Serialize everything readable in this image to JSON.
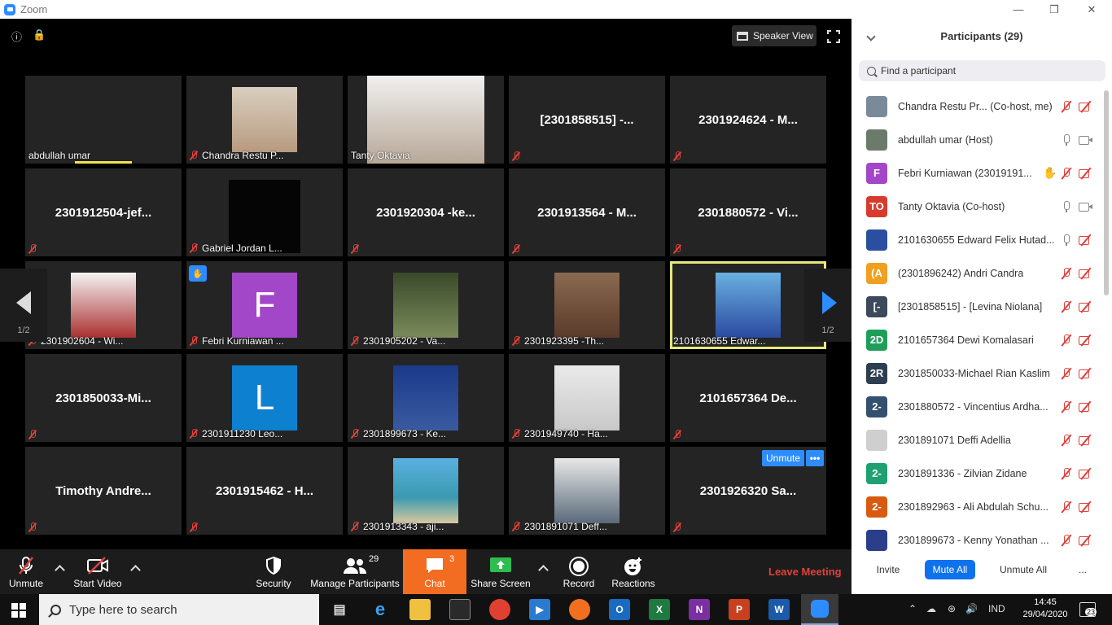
{
  "window": {
    "title": "Zoom"
  },
  "video": {
    "speaker_view_label": "Speaker View",
    "page_indicator": "1/2",
    "tiles": [
      {
        "label": "abdullah umar",
        "center": "",
        "muted": false
      },
      {
        "label": "Chandra Restu P...",
        "center": "",
        "muted": true
      },
      {
        "label": "Tanty Oktavia",
        "center": "",
        "muted": false
      },
      {
        "label": "",
        "center": "[2301858515] -...",
        "muted": true
      },
      {
        "label": "",
        "center": "2301924624 - M...",
        "muted": true
      },
      {
        "label": "",
        "center": "2301912504-jef...",
        "muted": true
      },
      {
        "label": "Gabriel Jordan L...",
        "center": "",
        "muted": true
      },
      {
        "label": "",
        "center": "2301920304 -ke...",
        "muted": true
      },
      {
        "label": "",
        "center": "2301913564 - M...",
        "muted": true
      },
      {
        "label": "",
        "center": "2301880572 - Vi...",
        "muted": true
      },
      {
        "label": "2301902604 - Wi...",
        "center": "",
        "muted": true
      },
      {
        "label": "Febri Kurniawan ...",
        "center": "",
        "muted": true,
        "avatar": "F"
      },
      {
        "label": "2301905202 - Va...",
        "center": "",
        "muted": true
      },
      {
        "label": "2301923395 -Th...",
        "center": "",
        "muted": true
      },
      {
        "label": "2101630655 Edwar...",
        "center": "",
        "muted": false
      },
      {
        "label": "",
        "center": "2301850033-Mi...",
        "muted": true
      },
      {
        "label": "2301911230 Leo...",
        "center": "",
        "muted": true,
        "avatar": "L"
      },
      {
        "label": "2301899673 - Ke...",
        "center": "",
        "muted": true
      },
      {
        "label": "2301949740 - Ha...",
        "center": "",
        "muted": true
      },
      {
        "label": "",
        "center": "2101657364 De...",
        "muted": true
      },
      {
        "label": "",
        "center": "Timothy  Andre...",
        "muted": true
      },
      {
        "label": "",
        "center": "2301915462 - H...",
        "muted": true
      },
      {
        "label": "2301913343 - aji...",
        "center": "",
        "muted": true
      },
      {
        "label": "2301891071 Deff...",
        "center": "",
        "muted": true
      },
      {
        "label": "",
        "center": "2301926320 Sa...",
        "muted": true
      }
    ],
    "unmute_pill": "Unmute",
    "more_pill": "•••"
  },
  "toolbar": {
    "unmute": "Unmute",
    "start_video": "Start Video",
    "security": "Security",
    "manage_participants": "Manage Participants",
    "participants_count": "29",
    "chat": "Chat",
    "chat_count": "3",
    "share_screen": "Share Screen",
    "record": "Record",
    "reactions": "Reactions",
    "leave": "Leave Meeting"
  },
  "panel": {
    "title": "Participants (29)",
    "search_placeholder": "Find a participant",
    "participants": [
      {
        "initials": "",
        "color": "#7a8a9a",
        "name": "Chandra Restu Pr...  (Co-host, me)",
        "mic": "off",
        "cam": "off"
      },
      {
        "initials": "",
        "color": "#6b7a6b",
        "name": "abdullah umar (Host)",
        "mic": "on",
        "cam": "on"
      },
      {
        "initials": "F",
        "color": "#a347c9",
        "name": "Febri Kurniawan (23019191...",
        "mic": "off",
        "cam": "off",
        "hand": true
      },
      {
        "initials": "TO",
        "color": "#d83a2e",
        "name": "Tanty Oktavia (Co-host)",
        "mic": "on",
        "cam": "on"
      },
      {
        "initials": "",
        "color": "#2b4fa0",
        "name": "2101630655 Edward Felix Hutad...",
        "mic": "on",
        "cam": "off"
      },
      {
        "initials": "(A",
        "color": "#f0a020",
        "name": "(2301896242) Andri Candra",
        "mic": "off",
        "cam": "off"
      },
      {
        "initials": "[-",
        "color": "#3c4a5c",
        "name": "[2301858515] - [Levina Niolana]",
        "mic": "off",
        "cam": "off"
      },
      {
        "initials": "2D",
        "color": "#1f9e5a",
        "name": "2101657364 Dewi Komalasari",
        "mic": "off",
        "cam": "off"
      },
      {
        "initials": "2R",
        "color": "#2d3e50",
        "name": "2301850033-Michael Rian Kaslim",
        "mic": "off",
        "cam": "off"
      },
      {
        "initials": "2-",
        "color": "#33506e",
        "name": "2301880572 - Vincentius Ardha...",
        "mic": "off",
        "cam": "off"
      },
      {
        "initials": "",
        "color": "#cfcfcf",
        "name": "2301891071 Deffi Adellia",
        "mic": "off",
        "cam": "off"
      },
      {
        "initials": "2-",
        "color": "#1fa070",
        "name": "2301891336 - Zilvian Zidane",
        "mic": "off",
        "cam": "off"
      },
      {
        "initials": "2-",
        "color": "#d85a10",
        "name": "2301892963 - Ali Abdulah Schu...",
        "mic": "off",
        "cam": "off"
      },
      {
        "initials": "",
        "color": "#2a3e8a",
        "name": "2301899673 - Kenny Yonathan ...",
        "mic": "off",
        "cam": "off"
      }
    ],
    "invite": "Invite",
    "mute_all": "Mute All",
    "unmute_all": "Unmute All",
    "more": "..."
  },
  "taskbar": {
    "search_placeholder": "Type here to search",
    "language": "IND",
    "time": "14:45",
    "date": "29/04/2020",
    "notifications": "23"
  },
  "colors": {
    "accent": "#2d8cff",
    "chat": "#f26d21",
    "muted": "#e0403a",
    "active_border": "#e6e87a"
  }
}
